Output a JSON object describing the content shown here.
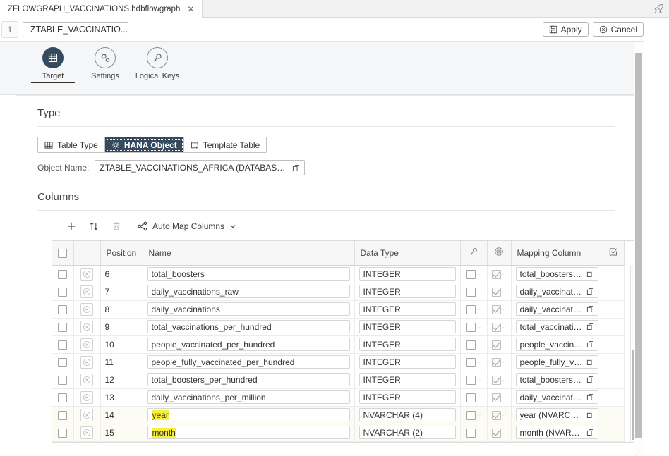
{
  "window": {
    "file_tab": "ZFLOWGRAPH_VACCINATIONS.hdbflowgraph",
    "close_icon": "close-icon",
    "rocket_icon": "rocket-icon"
  },
  "actionbar": {
    "index": "1",
    "node_name": "ZTABLE_VACCINATIO...",
    "apply_label": "Apply",
    "apply_icon": "save-icon",
    "cancel_label": "Cancel",
    "cancel_icon": "circle-x-icon",
    "count": "0"
  },
  "icon_tabs": [
    {
      "label": "Target",
      "icon": "grid-table-icon",
      "active": true
    },
    {
      "label": "Settings",
      "icon": "gears-icon",
      "active": false
    },
    {
      "label": "Logical Keys",
      "icon": "key-icon",
      "active": false
    }
  ],
  "type_section": {
    "title": "Type",
    "segments": [
      {
        "label": "Table Type",
        "icon": "table-grid-icon",
        "selected": false
      },
      {
        "label": "HANA Object",
        "icon": "hana-object-icon",
        "selected": true
      },
      {
        "label": "Template Table",
        "icon": "template-table-icon",
        "selected": false
      }
    ],
    "object_name_label": "Object Name:",
    "object_name_value": "ZTABLE_VACCINATIONS_AFRICA (DATABASE_TAB...",
    "value_help_icon": "value-help-icon"
  },
  "columns_section": {
    "title": "Columns",
    "toolbar": {
      "add_icon": "plus-icon",
      "sort_icon": "sort-icon",
      "delete_icon": "trash-icon",
      "automap_icon": "branch-icon",
      "automap_label": "Auto Map Columns",
      "automap_chevron": "chevron-down-icon"
    },
    "headers": {
      "select_all": "select-all-checkbox",
      "actions": "",
      "position": "Position",
      "name": "Name",
      "data_type": "Data Type",
      "key": "key-icon",
      "target": "target-icon",
      "mapping_column": "Mapping Column",
      "select_mapped": "checkbox-check-icon"
    },
    "rows": [
      {
        "position": "6",
        "name": "total_boosters",
        "data_type": "INTEGER",
        "key": false,
        "target": true,
        "mapping": "total_boosters (I...",
        "highlight": false
      },
      {
        "position": "7",
        "name": "daily_vaccinations_raw",
        "data_type": "INTEGER",
        "key": false,
        "target": true,
        "mapping": "daily_vaccinatio...",
        "highlight": false
      },
      {
        "position": "8",
        "name": "daily_vaccinations",
        "data_type": "INTEGER",
        "key": false,
        "target": true,
        "mapping": "daily_vaccinatio...",
        "highlight": false
      },
      {
        "position": "9",
        "name": "total_vaccinations_per_hundred",
        "data_type": "INTEGER",
        "key": false,
        "target": true,
        "mapping": "total_vaccinatio...",
        "highlight": false
      },
      {
        "position": "10",
        "name": "people_vaccinated_per_hundred",
        "data_type": "INTEGER",
        "key": false,
        "target": true,
        "mapping": "people_vaccinat...",
        "highlight": false
      },
      {
        "position": "11",
        "name": "people_fully_vaccinated_per_hundred",
        "data_type": "INTEGER",
        "key": false,
        "target": true,
        "mapping": "people_fully_va...",
        "highlight": false
      },
      {
        "position": "12",
        "name": "total_boosters_per_hundred",
        "data_type": "INTEGER",
        "key": false,
        "target": true,
        "mapping": "total_boosters_...",
        "highlight": false
      },
      {
        "position": "13",
        "name": "daily_vaccinations_per_million",
        "data_type": "INTEGER",
        "key": false,
        "target": true,
        "mapping": "daily_vaccinatio...",
        "highlight": false
      },
      {
        "position": "14",
        "name": "year",
        "data_type": "NVARCHAR (4)",
        "key": false,
        "target": true,
        "mapping": "year (NVARCH...",
        "highlight": true
      },
      {
        "position": "15",
        "name": "month",
        "data_type": "NVARCHAR (2)",
        "key": false,
        "target": true,
        "mapping": "month (NVARC...",
        "highlight": true
      }
    ]
  },
  "colors": {
    "accent": "#354a5f",
    "highlight": "#f8ef3a",
    "header_bg": "#f7f7f7",
    "border": "#dcdcdc"
  }
}
